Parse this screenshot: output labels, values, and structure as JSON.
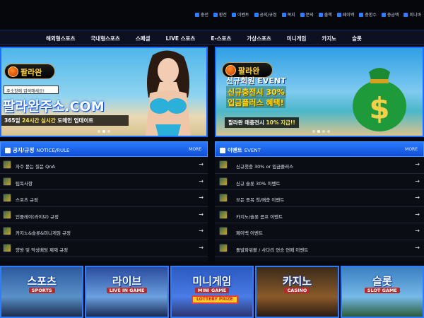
{
  "topbar": {
    "links": [
      "충전",
      "환전",
      "이벤트",
      "공지/규정",
      "쪽지",
      "문의",
      "출첵",
      "페이백",
      "충환수",
      "충금액",
      "미니바"
    ]
  },
  "nav": {
    "items": [
      "해외형스포츠",
      "국내형스포츠",
      "스페셜",
      "LIVE 스포츠",
      "E-스포츠",
      "가상스포츠",
      "미니게임",
      "카지노",
      "슬롯"
    ]
  },
  "banner_left": {
    "logo": "팔라완",
    "logo_sub": "CASINO & SLOT & SPORTS",
    "search_text": "주소창에 검색해세요!",
    "domain": "팔라완주소.COM",
    "ticker_pre": "365일 ",
    "ticker_hl": "24시간 실시간",
    "ticker_post": " 도메인 업데이트"
  },
  "banner_right": {
    "logo": "팔라완",
    "title": "신규회원 EVENT",
    "line1": "신규충전시 30%",
    "line2": "입금플러스 혜택!",
    "bottom_pre": "팔라완 매충전시 ",
    "bottom_hl": "10% 지급!!"
  },
  "notice": {
    "title": "공지/규정",
    "title_en": "NOTICE/RULE",
    "more": "MORE",
    "items": [
      "자주 묻는 질문 QnA",
      "팁독사항",
      "스포츠 규정",
      "인플레이(라이브) 규정",
      "카지노&슬롯&미니게임 규정",
      "양방 및 악성배팅 제재 규정"
    ]
  },
  "event": {
    "title": "이벤트",
    "title_en": "EVENT",
    "more": "MORE",
    "items": [
      "신규첫충 30% or 입금플러스",
      "신규 슬롯 30% 이벤트",
      "모든 종목 첫/매충 이벤트",
      "카지노/슬롯 콤프 이벤트",
      "페이백 이벤트",
      "돌발파워볼 / 사다리 연승 연패 이벤트"
    ]
  },
  "tiles": [
    {
      "big": "스포츠",
      "small": "SPORTS"
    },
    {
      "big": "라이브",
      "small": "LIVE IN GAME"
    },
    {
      "big": "미니게임",
      "small": "MINI GAME",
      "extra": "LOTTERY PRIZE"
    },
    {
      "big": "카지노",
      "small": "CASINO"
    },
    {
      "big": "슬롯",
      "small": "SLOT GAME"
    }
  ]
}
